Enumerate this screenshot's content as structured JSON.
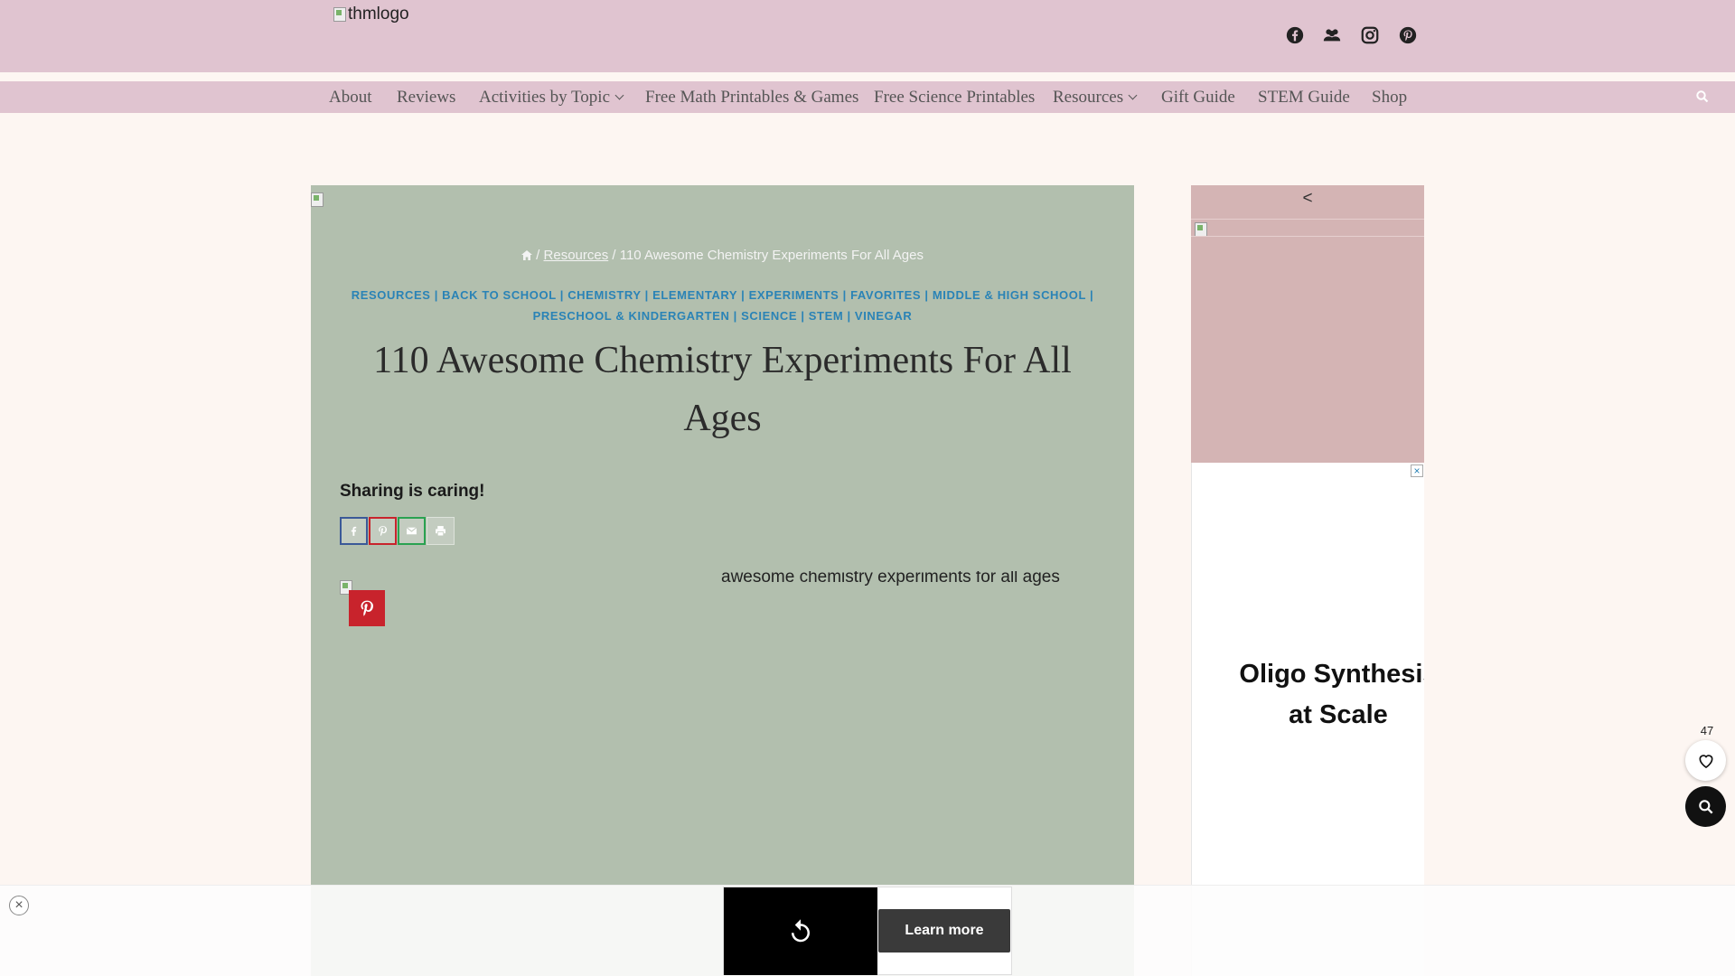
{
  "header": {
    "logo_alt": "thmlogo",
    "social_icons": [
      "facebook-icon",
      "facebook-group-icon",
      "instagram-icon",
      "pinterest-icon"
    ]
  },
  "nav": {
    "items": [
      "About",
      "Reviews",
      "Activities by Topic",
      "Free Math Printables & Games",
      "Free Science Printables",
      "Resources",
      "Gift Guide",
      "STEM Guide",
      "Shop"
    ]
  },
  "article": {
    "breadcrumb": {
      "separator1": "/",
      "link": "Resources",
      "separator2": "/",
      "current": "110 Awesome Chemistry Experiments For All Ages"
    },
    "categories_line1": "RESOURCES | BACK TO SCHOOL | CHEMISTRY | ELEMENTARY | EXPERIMENTS | FAVORITES | MIDDLE & HIGH SCHOOL |",
    "categories_line2": "PRESCHOOL & KINDERGARTEN | SCIENCE | STEM | VINEGAR",
    "title_line1": "110 Awesome Chemistry Experiments For All",
    "title_line2": "Ages",
    "sharing_heading": "Sharing is caring!",
    "image_alt": "awesome chemistry experiments for all ages"
  },
  "sidebar": {
    "arrow": "<",
    "ad_close": "×",
    "ad_headline_line1": "Oligo Synthesis",
    "ad_headline_line2": "at Scale"
  },
  "floating": {
    "favorites_count": "47"
  },
  "bottom_ad": {
    "close": "×",
    "cta": "Learn more"
  },
  "colors": {
    "header_bg": "#e0c4d0",
    "article_bg": "#b2bfae",
    "category_link": "#2a83b6",
    "pinterest_red": "#c8232c"
  }
}
